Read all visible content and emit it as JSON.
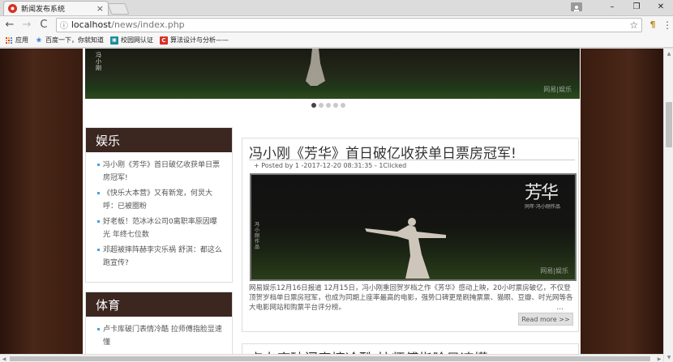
{
  "browser": {
    "tab_title": "新闻发布系统",
    "tab_close": "×",
    "url_host": "localhost",
    "url_path": "/news/index.php",
    "window_buttons": [
      "–",
      "❐",
      "✕"
    ],
    "bookmarks": [
      {
        "label": "应用",
        "icon": "apps-grid-icon"
      },
      {
        "label": "百度一下，你就知道",
        "icon": "baidu-paw-icon"
      },
      {
        "label": "校园网认证",
        "icon": "campus-network-icon"
      },
      {
        "label": "算法设计与分析——",
        "icon": "c-letter-icon"
      }
    ],
    "icons": {
      "back": "←",
      "forward": "→",
      "reload": "C",
      "info": "ⓘ",
      "star": "☆",
      "extension": "¶",
      "menu": "⋮"
    }
  },
  "slider": {
    "vertical_text": "冯小刚",
    "watermark": "网易|娱乐",
    "dots": [
      true,
      false,
      false,
      false,
      false
    ]
  },
  "sidebar": {
    "entertainment": {
      "title": "娱乐",
      "items": [
        "冯小刚《芳华》首日破亿收获单日票房冠军!",
        "《快乐大本营》又有新宠，何炅大呼：已被圈粉",
        "好老板！范冰冰公司0离职率原因曝光 年终七位数",
        "邓超被摔阵赫李灾乐祸 舒淇：都这么跑宣传?"
      ]
    },
    "sports": {
      "title": "体育",
      "items": [
        "卢卡库破门表情冷酷 拉师傅指脸显速懂"
      ]
    }
  },
  "article": {
    "title": "冯小刚《芳华》首日破亿收获单日票房冠军!",
    "meta": "+ Posted by 1 -2017-12-20 08:31:35 - 1Clicked",
    "image": {
      "poster_title": "芳华",
      "poster_sub": "同年·冯小刚作品",
      "vertical_text": "冯小刚作品",
      "watermark": "网易|娱乐"
    },
    "excerpt": "网易娱乐12月16日报道 12月15日，冯小刚重回贺岁档之作《芳华》感动上映，20小时票房破亿，不仅登顶贺岁档单日票房冠军，也成为同期上座率最高的电影，强势口碑更是刷掩票票、猫眼、豆瓣、时光网等各大电影网站和购票平台评分榜。",
    "ellipsis": "...",
    "read_more": "Read more >>"
  },
  "article2": {
    "title": "卢卡库破门表情冷酷 拉师傅指脸显速懂"
  },
  "colors": {
    "widget_header": "#3b2620",
    "bullet": "#4aa0d8",
    "page_bg_side": "#3b1f14"
  }
}
